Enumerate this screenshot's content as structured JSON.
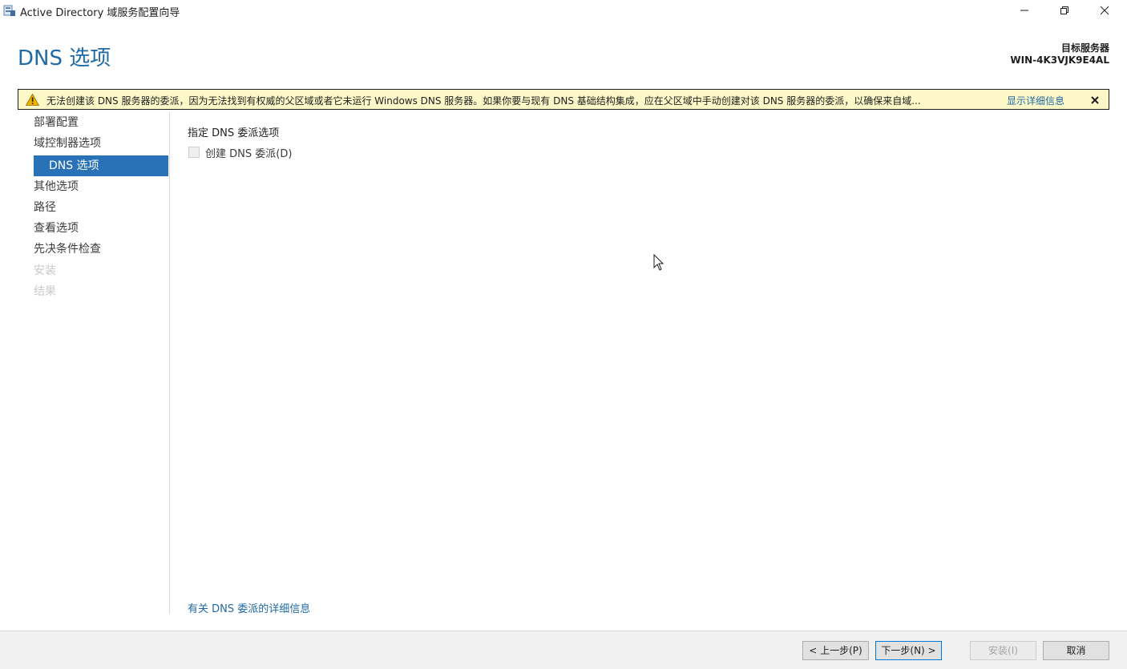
{
  "window": {
    "title": "Active Directory 域服务配置向导"
  },
  "header": {
    "page_title": "DNS 选项",
    "target_server_label": "目标服务器",
    "target_server_name": "WIN-4K3VJK9E4AL"
  },
  "warning": {
    "text": "无法创建该 DNS 服务器的委派，因为无法找到有权威的父区域或者它未运行 Windows DNS 服务器。如果你要与现有 DNS 基础结构集成，应在父区域中手动创建对该 DNS 服务器的委派，以确保来自域...",
    "link": "显示详细信息"
  },
  "nav": {
    "items": [
      {
        "label": "部署配置",
        "state": "normal"
      },
      {
        "label": "域控制器选项",
        "state": "normal"
      },
      {
        "label": "DNS 选项",
        "state": "active"
      },
      {
        "label": "其他选项",
        "state": "normal"
      },
      {
        "label": "路径",
        "state": "normal"
      },
      {
        "label": "查看选项",
        "state": "normal"
      },
      {
        "label": "先决条件检查",
        "state": "normal"
      },
      {
        "label": "安装",
        "state": "disabled"
      },
      {
        "label": "结果",
        "state": "disabled"
      }
    ]
  },
  "main": {
    "section_label": "指定 DNS 委派选项",
    "checkbox_label": "创建 DNS 委派(D)",
    "help_link": "有关 DNS 委派的详细信息"
  },
  "footer": {
    "prev_label": "< 上一步(P)",
    "next_label": "下一步(N) >",
    "install_label": "安装(I)",
    "cancel_label": "取消"
  },
  "colors": {
    "accent": "#1f6aa5",
    "nav_active": "#2a72b8",
    "warning_bg": "#fdf8c8"
  }
}
